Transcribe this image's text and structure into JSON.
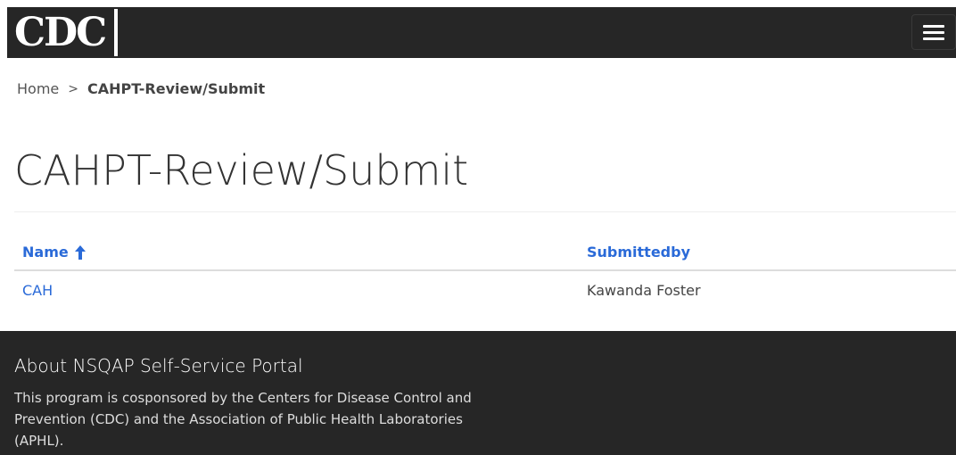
{
  "header": {
    "logo_text": "CDC",
    "menu_icon": "hamburger-menu-icon"
  },
  "breadcrumb": {
    "home": "Home",
    "separator": ">",
    "current": "CAHPT-Review/Submit"
  },
  "page": {
    "title": "CAHPT-Review/Submit"
  },
  "table": {
    "columns": [
      {
        "label": "Name",
        "sort_icon": "arrow-up-icon"
      },
      {
        "label": "Submittedby"
      }
    ],
    "rows": [
      {
        "name": "CAH",
        "submittedby": "Kawanda Foster"
      }
    ]
  },
  "footer": {
    "heading": "About NSQAP Self-Service Portal",
    "text": "This program is cosponsored by the Centers for Disease Control and Prevention (CDC) and the Association of Public Health Laboratories (APHL)."
  },
  "colors": {
    "navbar_bg": "#262626",
    "link": "#2a6ad8",
    "footer_bg": "#262626"
  }
}
